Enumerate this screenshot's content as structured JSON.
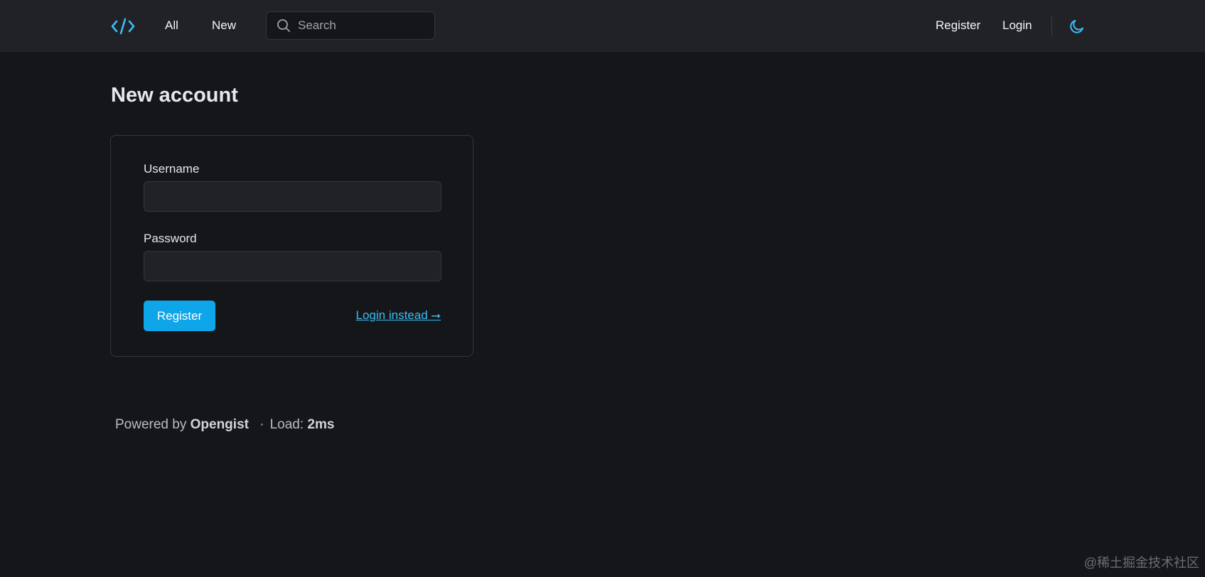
{
  "nav": {
    "logo_icon": "code-brackets-icon",
    "all_label": "All",
    "new_label": "New",
    "search_placeholder": "Search",
    "register_label": "Register",
    "login_label": "Login",
    "theme_icon": "moon-icon"
  },
  "page": {
    "title": "New account"
  },
  "form": {
    "username_label": "Username",
    "username_value": "",
    "password_label": "Password",
    "password_value": "",
    "submit_label": "Register",
    "login_instead_label": "Login instead",
    "login_instead_arrow": "⭢"
  },
  "footer": {
    "powered_by_label": "Powered by",
    "brand": "Opengist",
    "separator": "·",
    "load_label": "Load:",
    "load_value": "2ms"
  },
  "watermark": {
    "text": "@稀土掘金技术社区"
  },
  "colors": {
    "accent": "#0ea5e9",
    "link": "#38bdf8",
    "background": "#151619",
    "navbar": "#202226"
  }
}
